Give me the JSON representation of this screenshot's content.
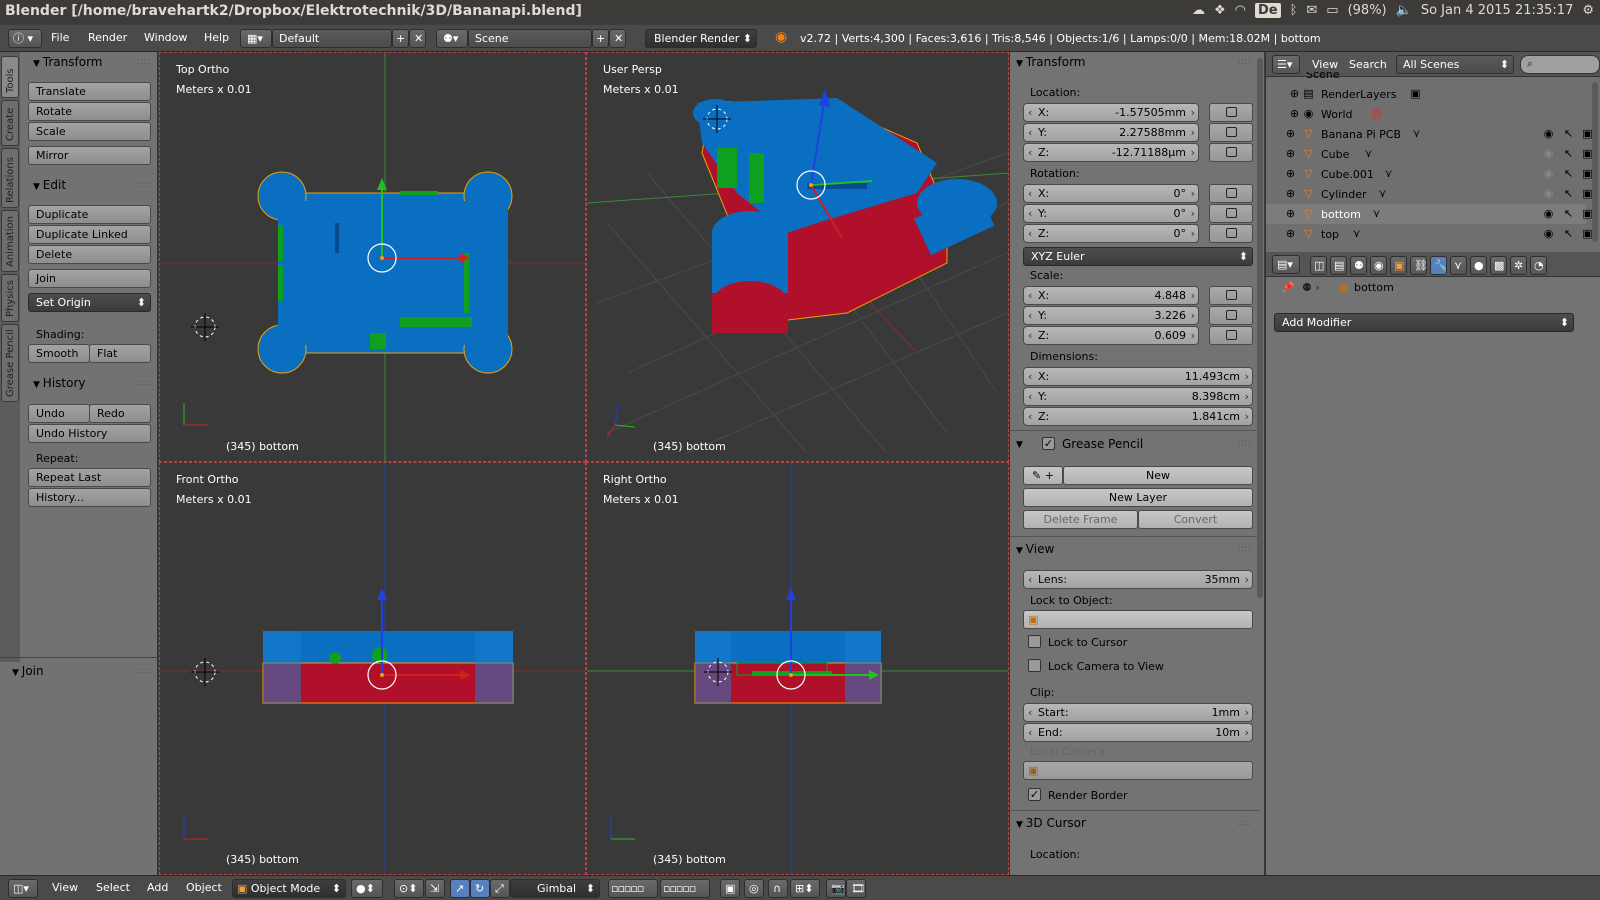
{
  "os_bar": {
    "window_title": "Blender [/home/bravehartk2/Dropbox/Elektrotechnik/3D/Bananapi.blend]",
    "keyboard_layout": "De",
    "battery": "(98%)",
    "clock": "So Jan  4 2015 21:35:17"
  },
  "info_header": {
    "menus": [
      "File",
      "Render",
      "Window",
      "Help"
    ],
    "screen_layout": "Default",
    "scene": "Scene",
    "render_engine": "Blender Render",
    "stats": "v2.72 | Verts:4,300 | Faces:3,616 | Tris:8,546 | Objects:1/6 | Lamps:0/0 | Mem:18.02M | bottom"
  },
  "tool_tabs": [
    "Tools",
    "Create",
    "Relations",
    "Animation",
    "Physics",
    "Grease Pencil"
  ],
  "tool_shelf": {
    "transform_header": "Transform",
    "translate": "Translate",
    "rotate": "Rotate",
    "scale": "Scale",
    "mirror": "Mirror",
    "edit_header": "Edit",
    "duplicate": "Duplicate",
    "duplicate_linked": "Duplicate Linked",
    "delete": "Delete",
    "join": "Join",
    "set_origin": "Set Origin",
    "shading_label": "Shading:",
    "smooth": "Smooth",
    "flat": "Flat",
    "history_header": "History",
    "undo": "Undo",
    "redo": "Redo",
    "undo_history": "Undo History",
    "repeat_label": "Repeat:",
    "repeat_last": "Repeat Last",
    "history_more": "History...",
    "last_op_header": "Join"
  },
  "viewports": {
    "top": {
      "name": "Top Ortho",
      "units": "Meters x 0.01",
      "footer": "(345) bottom"
    },
    "persp": {
      "name": "User Persp",
      "units": "Meters x 0.01",
      "footer": "(345) bottom"
    },
    "front": {
      "name": "Front Ortho",
      "units": "Meters x 0.01",
      "footer": "(345) bottom"
    },
    "right": {
      "name": "Right Ortho",
      "units": "Meters x 0.01",
      "footer": "(345) bottom"
    }
  },
  "properties": {
    "transform_header": "Transform",
    "location_label": "Location:",
    "location": {
      "x": "-1.57505mm",
      "y": "2.27588mm",
      "z": "-12.71188µm"
    },
    "rotation_label": "Rotation:",
    "rotation": {
      "x": "0°",
      "y": "0°",
      "z": "0°"
    },
    "rotation_mode": "XYZ Euler",
    "scale_label": "Scale:",
    "scale": {
      "x": "4.848",
      "y": "3.226",
      "z": "0.609"
    },
    "dimensions_label": "Dimensions:",
    "dimensions": {
      "x": "11.493cm",
      "y": "8.398cm",
      "z": "1.841cm"
    },
    "axis_x": "X:",
    "axis_y": "Y:",
    "axis_z": "Z:",
    "grease_pencil_header": "Grease Pencil",
    "gp_new": "New",
    "gp_new_layer": "New Layer",
    "gp_delete_frame": "Delete Frame",
    "gp_convert": "Convert",
    "view_header": "View",
    "lens_label": "Lens:",
    "lens_value": "35mm",
    "lock_to_object_label": "Lock to Object:",
    "lock_to_cursor": "Lock to Cursor",
    "lock_camera_to_view": "Lock Camera to View",
    "clip_label": "Clip:",
    "clip_start_label": "Start:",
    "clip_start": "1mm",
    "clip_end_label": "End:",
    "clip_end": "10m",
    "local_camera_label": "Local Camera:",
    "render_border": "Render Border",
    "cursor_header": "3D Cursor",
    "cursor_location_label": "Location:"
  },
  "outliner": {
    "view_menu": "View",
    "search_menu": "Search",
    "display_mode": "All Scenes",
    "scene_root": "Scene",
    "items": [
      {
        "name": "RenderLayers",
        "type": "renderlayers"
      },
      {
        "name": "World",
        "type": "world"
      },
      {
        "name": "Banana Pi PCB",
        "type": "mesh"
      },
      {
        "name": "Cube",
        "type": "mesh"
      },
      {
        "name": "Cube.001",
        "type": "mesh"
      },
      {
        "name": "Cylinder",
        "type": "mesh"
      },
      {
        "name": "bottom",
        "type": "mesh"
      },
      {
        "name": "top",
        "type": "mesh"
      }
    ]
  },
  "modifiers": {
    "object_name": "bottom",
    "add_modifier": "Add Modifier"
  },
  "view3d_header": {
    "menus": [
      "View",
      "Select",
      "Add",
      "Object"
    ],
    "mode": "Object Mode",
    "orientation": "Gimbal"
  },
  "colors": {
    "object_blue": "#0a6fc0",
    "object_red": "#b0102a",
    "pcb_green": "#10a020",
    "selection_orange": "#f0a000"
  }
}
